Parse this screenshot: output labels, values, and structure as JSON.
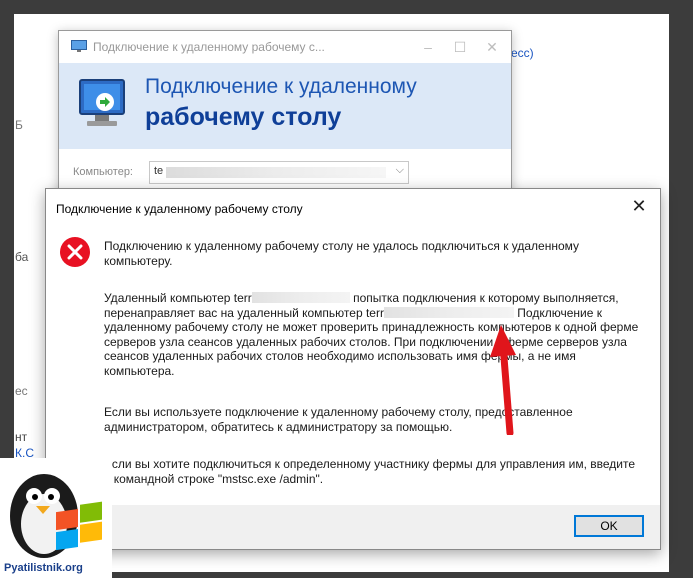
{
  "background": {
    "link_top": "есс)",
    "frag_1": "Б",
    "frag_2": "ба",
    "frag_3": "нт",
    "frag_4": "К.С",
    "frag_5": "ес"
  },
  "rdp_window": {
    "title": "Подключение к удаленному рабочему с...",
    "heading_line1": "Подключение к удаленному",
    "heading_line2": "рабочему столу",
    "computer_label": "Компьютер:",
    "computer_value": "te"
  },
  "dialog": {
    "title": "Подключение к удаленному рабочему столу",
    "p1": "Подключению к удаленному рабочему столу не удалось подключиться к удаленному компьютеру.",
    "p2_a": "Удаленный компьютер terr",
    "p2_b": " попытка подключения к которому выполняется, перенаправляет вас на удаленный компьютер terr",
    "p2_c": " Подключение к удаленному рабочему столу не может проверить принадлежность компьютеров к одной ферме серверов узла сеансов удаленных рабочих столов. При подключении к ферме серверов узла сеансов удаленных рабочих столов необходимо использовать имя фермы, а не имя компьютера.",
    "p3": "Если вы используете подключение к удаленному рабочему столу, предоставленное администратором, обратитесь к администратору за помощью.",
    "p4": "Если вы хотите подключиться к определенному участнику фермы для управления им, введите в командной строке \"mstsc.exe /admin\".",
    "ok_label": "OK"
  },
  "watermark": {
    "text": "Pyatilistnik.org"
  },
  "colors": {
    "accent": "#0078d7",
    "heading": "#1d56b3",
    "arrow": "#e0151b",
    "error": "#e81123"
  }
}
